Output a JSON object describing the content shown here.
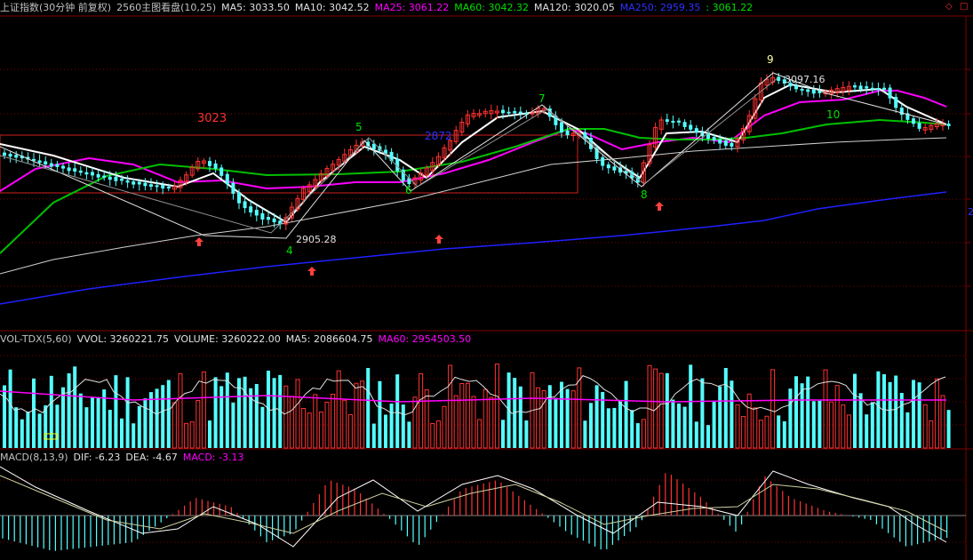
{
  "header": {
    "index_name": "上证指数(30分钟 前复权)",
    "indicator": "2560主图看盘(10,25)",
    "ma5": "MA5: 3033.50",
    "ma10": "MA10: 3042.52",
    "ma25": "MA25: 3061.22",
    "ma60": "MA60: 3042.32",
    "ma120": "MA120: 3020.05",
    "ma250": "MA250: 2959.35",
    "extra": ": 3061.22"
  },
  "corner_icons": [
    "diamond-icon",
    "square-icon"
  ],
  "annotations": {
    "box_level": "3023",
    "box_level2": "2872",
    "low_price": "2905.28",
    "high_price": "3097.16",
    "waves": [
      "4",
      "5",
      "6",
      "7",
      "8",
      "9",
      "10"
    ],
    "right_edge": "2"
  },
  "volume_panel": {
    "name": "VOL-TDX(5,60)",
    "vvol": "VVOL: 3260221.75",
    "volume": "VOLUME: 3260222.00",
    "ma5": "MA5: 2086604.75",
    "ma60": "MA60: 2954503.50"
  },
  "macd_panel": {
    "name": "MACD(8,13,9)",
    "dif": "DIF: -6.23",
    "dea": "DEA: -4.67",
    "macd": "MACD: -3.13"
  },
  "colors": {
    "up": "#ff3232",
    "down": "#54ffff",
    "ma5": "#ffffff",
    "ma25": "#ff00ff",
    "ma60": "#00c000",
    "ma250": "#0000ff",
    "grid": "#800000",
    "header": "#c0c0c0"
  }
}
